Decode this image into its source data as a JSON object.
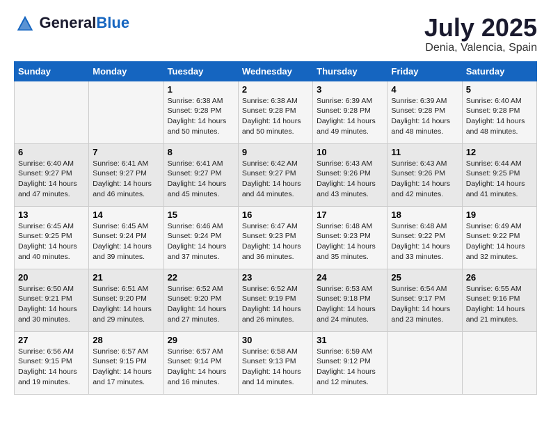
{
  "logo": {
    "general": "General",
    "blue": "Blue"
  },
  "title": "July 2025",
  "location": "Denia, Valencia, Spain",
  "days_of_week": [
    "Sunday",
    "Monday",
    "Tuesday",
    "Wednesday",
    "Thursday",
    "Friday",
    "Saturday"
  ],
  "weeks": [
    [
      {
        "day": "",
        "info": ""
      },
      {
        "day": "",
        "info": ""
      },
      {
        "day": "1",
        "info": "Sunrise: 6:38 AM\nSunset: 9:28 PM\nDaylight: 14 hours and 50 minutes."
      },
      {
        "day": "2",
        "info": "Sunrise: 6:38 AM\nSunset: 9:28 PM\nDaylight: 14 hours and 50 minutes."
      },
      {
        "day": "3",
        "info": "Sunrise: 6:39 AM\nSunset: 9:28 PM\nDaylight: 14 hours and 49 minutes."
      },
      {
        "day": "4",
        "info": "Sunrise: 6:39 AM\nSunset: 9:28 PM\nDaylight: 14 hours and 48 minutes."
      },
      {
        "day": "5",
        "info": "Sunrise: 6:40 AM\nSunset: 9:28 PM\nDaylight: 14 hours and 48 minutes."
      }
    ],
    [
      {
        "day": "6",
        "info": "Sunrise: 6:40 AM\nSunset: 9:27 PM\nDaylight: 14 hours and 47 minutes."
      },
      {
        "day": "7",
        "info": "Sunrise: 6:41 AM\nSunset: 9:27 PM\nDaylight: 14 hours and 46 minutes."
      },
      {
        "day": "8",
        "info": "Sunrise: 6:41 AM\nSunset: 9:27 PM\nDaylight: 14 hours and 45 minutes."
      },
      {
        "day": "9",
        "info": "Sunrise: 6:42 AM\nSunset: 9:27 PM\nDaylight: 14 hours and 44 minutes."
      },
      {
        "day": "10",
        "info": "Sunrise: 6:43 AM\nSunset: 9:26 PM\nDaylight: 14 hours and 43 minutes."
      },
      {
        "day": "11",
        "info": "Sunrise: 6:43 AM\nSunset: 9:26 PM\nDaylight: 14 hours and 42 minutes."
      },
      {
        "day": "12",
        "info": "Sunrise: 6:44 AM\nSunset: 9:25 PM\nDaylight: 14 hours and 41 minutes."
      }
    ],
    [
      {
        "day": "13",
        "info": "Sunrise: 6:45 AM\nSunset: 9:25 PM\nDaylight: 14 hours and 40 minutes."
      },
      {
        "day": "14",
        "info": "Sunrise: 6:45 AM\nSunset: 9:24 PM\nDaylight: 14 hours and 39 minutes."
      },
      {
        "day": "15",
        "info": "Sunrise: 6:46 AM\nSunset: 9:24 PM\nDaylight: 14 hours and 37 minutes."
      },
      {
        "day": "16",
        "info": "Sunrise: 6:47 AM\nSunset: 9:23 PM\nDaylight: 14 hours and 36 minutes."
      },
      {
        "day": "17",
        "info": "Sunrise: 6:48 AM\nSunset: 9:23 PM\nDaylight: 14 hours and 35 minutes."
      },
      {
        "day": "18",
        "info": "Sunrise: 6:48 AM\nSunset: 9:22 PM\nDaylight: 14 hours and 33 minutes."
      },
      {
        "day": "19",
        "info": "Sunrise: 6:49 AM\nSunset: 9:22 PM\nDaylight: 14 hours and 32 minutes."
      }
    ],
    [
      {
        "day": "20",
        "info": "Sunrise: 6:50 AM\nSunset: 9:21 PM\nDaylight: 14 hours and 30 minutes."
      },
      {
        "day": "21",
        "info": "Sunrise: 6:51 AM\nSunset: 9:20 PM\nDaylight: 14 hours and 29 minutes."
      },
      {
        "day": "22",
        "info": "Sunrise: 6:52 AM\nSunset: 9:20 PM\nDaylight: 14 hours and 27 minutes."
      },
      {
        "day": "23",
        "info": "Sunrise: 6:52 AM\nSunset: 9:19 PM\nDaylight: 14 hours and 26 minutes."
      },
      {
        "day": "24",
        "info": "Sunrise: 6:53 AM\nSunset: 9:18 PM\nDaylight: 14 hours and 24 minutes."
      },
      {
        "day": "25",
        "info": "Sunrise: 6:54 AM\nSunset: 9:17 PM\nDaylight: 14 hours and 23 minutes."
      },
      {
        "day": "26",
        "info": "Sunrise: 6:55 AM\nSunset: 9:16 PM\nDaylight: 14 hours and 21 minutes."
      }
    ],
    [
      {
        "day": "27",
        "info": "Sunrise: 6:56 AM\nSunset: 9:15 PM\nDaylight: 14 hours and 19 minutes."
      },
      {
        "day": "28",
        "info": "Sunrise: 6:57 AM\nSunset: 9:15 PM\nDaylight: 14 hours and 17 minutes."
      },
      {
        "day": "29",
        "info": "Sunrise: 6:57 AM\nSunset: 9:14 PM\nDaylight: 14 hours and 16 minutes."
      },
      {
        "day": "30",
        "info": "Sunrise: 6:58 AM\nSunset: 9:13 PM\nDaylight: 14 hours and 14 minutes."
      },
      {
        "day": "31",
        "info": "Sunrise: 6:59 AM\nSunset: 9:12 PM\nDaylight: 14 hours and 12 minutes."
      },
      {
        "day": "",
        "info": ""
      },
      {
        "day": "",
        "info": ""
      }
    ]
  ]
}
